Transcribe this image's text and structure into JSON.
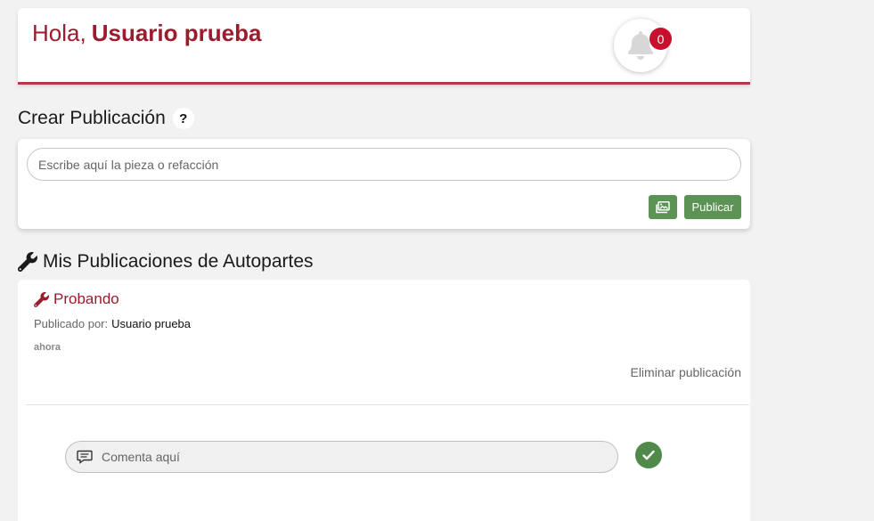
{
  "header": {
    "greeting": "Hola,",
    "user_name": "Usuario prueba",
    "notification_count": "0"
  },
  "create": {
    "title": "Crear Publicación",
    "help_label": "?",
    "input_placeholder": "Escribe aquí la pieza o refacción",
    "publish_label": "Publicar"
  },
  "my_posts": {
    "title": "Mis Publicaciones de Autopartes",
    "posts": [
      {
        "title": "Probando",
        "published_by_label": "Publicado por:",
        "author": "Usuario prueba",
        "time": "ahora",
        "delete_label": "Eliminar publicación",
        "comment_placeholder": "Comenta aquí"
      }
    ]
  },
  "colors": {
    "brand": "#9b1c2e",
    "accent_green": "#5a9354",
    "badge_red": "#c8102e"
  },
  "icons": {
    "notifications": "bell-icon",
    "help": "question-icon",
    "attach_image": "images-icon",
    "section": "wrench-icon",
    "comment": "comment-icon",
    "send": "check-icon"
  }
}
